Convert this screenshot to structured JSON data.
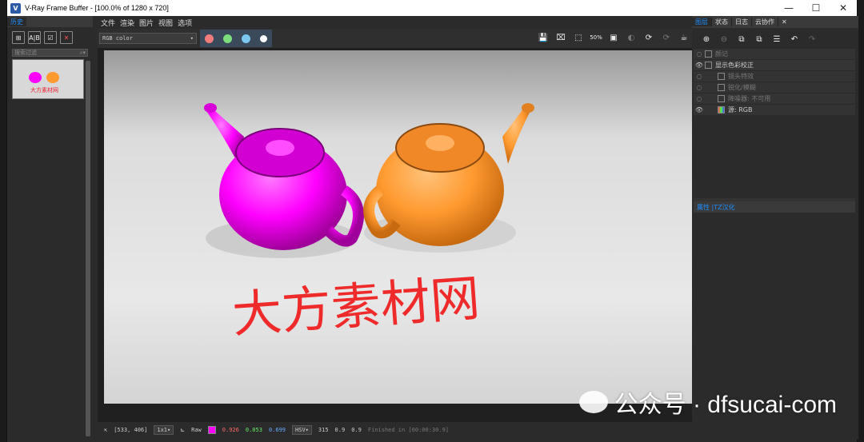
{
  "window": {
    "title": "V-Ray Frame Buffer - [100.0% of 1280 x 720]",
    "app_icon": "V",
    "minimize": "—",
    "maximize": "☐",
    "close": "✕"
  },
  "history": {
    "tab": "历史",
    "search_placeholder": "搜索过滤"
  },
  "menu": [
    "文件",
    "渲染",
    "图片",
    "视图",
    "选项"
  ],
  "toolbar": {
    "channel": "RGB color",
    "colors": {
      "red": "#f07c7c",
      "green": "#7cde7c",
      "blue": "#7cc7f0"
    }
  },
  "render": {
    "watermark_cn": "大方素材网",
    "teapot_left_color": "#ff00ff",
    "teapot_right_color": "#ff9a30"
  },
  "status": {
    "coords": "[533, 406]",
    "zoom": "1x1",
    "mode": "Raw",
    "r": "0.926",
    "g": "0.053",
    "b": "0.699",
    "space": "HSV",
    "h": "315",
    "s": "0.9",
    "v": "0.9",
    "finished": "Finished in [00:00:30.9]"
  },
  "right_tabs": [
    "图层",
    "状态",
    "日志",
    "云协作"
  ],
  "layers": [
    {
      "label": "显示色彩校正",
      "visible": true
    },
    {
      "label": "镜头特效",
      "visible": false
    },
    {
      "label": "锐化/模糊",
      "visible": false
    },
    {
      "label": "降噪器: 不可用",
      "visible": false
    },
    {
      "label": "源: RGB",
      "visible": true
    }
  ],
  "layers_top": "颜记",
  "props_tabs": "属性 |TZ汉化",
  "page_watermark": {
    "icon": "wechat-icon",
    "text": "公众号 · dfsucai-com"
  }
}
